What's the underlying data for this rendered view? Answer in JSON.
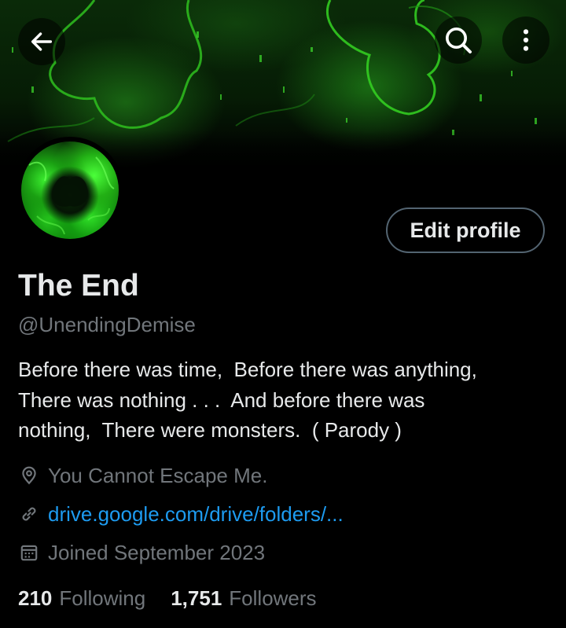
{
  "header": {
    "back_icon": "arrow-left-icon",
    "search_icon": "search-icon",
    "more_icon": "more-vertical-icon"
  },
  "profile": {
    "display_name": "The End",
    "handle": "@UnendingDemise",
    "edit_button_label": "Edit profile",
    "bio_lines": [
      "Before there was time,  Before there was anything,",
      "There was nothing . . .  And before there was",
      "nothing,  There were monsters.  ( Parody )"
    ],
    "location": "You Cannot Escape Me.",
    "website": "drive.google.com/drive/folders/...",
    "joined": "Joined September 2023",
    "following_count": "210",
    "following_label": "Following",
    "followers_count": "1,751",
    "followers_label": "Followers"
  },
  "colors": {
    "background": "#000000",
    "primary_text": "#e7e9ea",
    "secondary_text": "#71767b",
    "link": "#1d9bf0",
    "button_border": "#536471",
    "banner_accent": "#2ecc1f"
  }
}
